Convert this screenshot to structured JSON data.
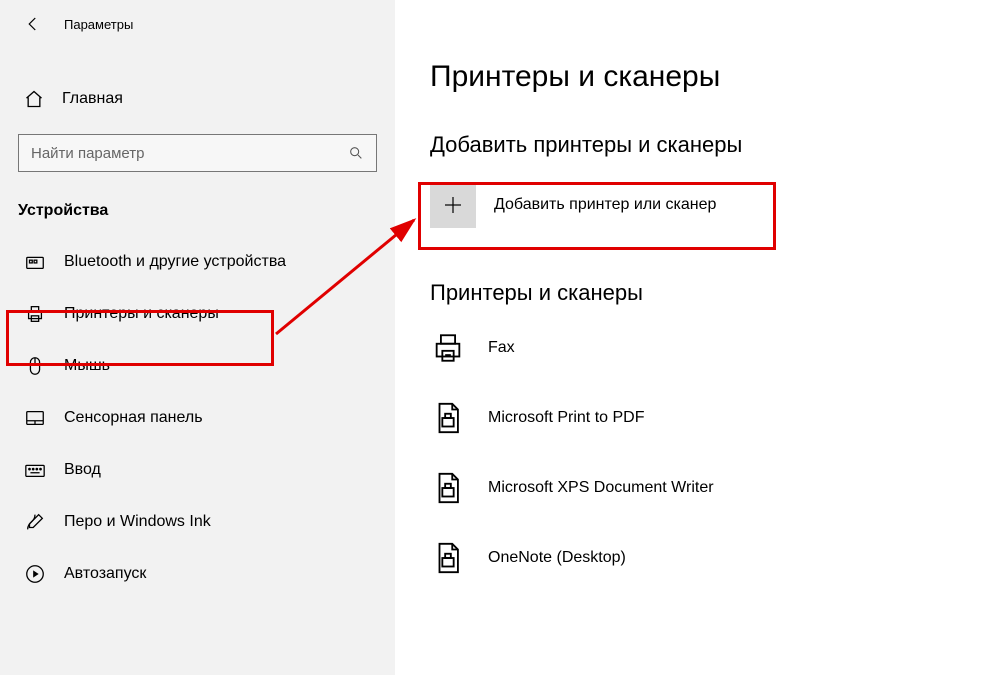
{
  "window": {
    "title": "Параметры"
  },
  "sidebar": {
    "home": "Главная",
    "search_placeholder": "Найти параметр",
    "category": "Устройства",
    "items": [
      {
        "label": "Bluetooth и другие устройства"
      },
      {
        "label": "Принтеры и сканеры"
      },
      {
        "label": "Мышь"
      },
      {
        "label": "Сенсорная панель"
      },
      {
        "label": "Ввод"
      },
      {
        "label": "Перо и Windows Ink"
      },
      {
        "label": "Автозапуск"
      }
    ]
  },
  "main": {
    "title": "Принтеры и сканеры",
    "add_section_title": "Добавить принтеры и сканеры",
    "add_label": "Добавить принтер или сканер",
    "list_section_title": "Принтеры и сканеры",
    "printers": [
      {
        "label": "Fax"
      },
      {
        "label": "Microsoft Print to PDF"
      },
      {
        "label": "Microsoft XPS Document Writer"
      },
      {
        "label": "OneNote (Desktop)"
      }
    ]
  }
}
